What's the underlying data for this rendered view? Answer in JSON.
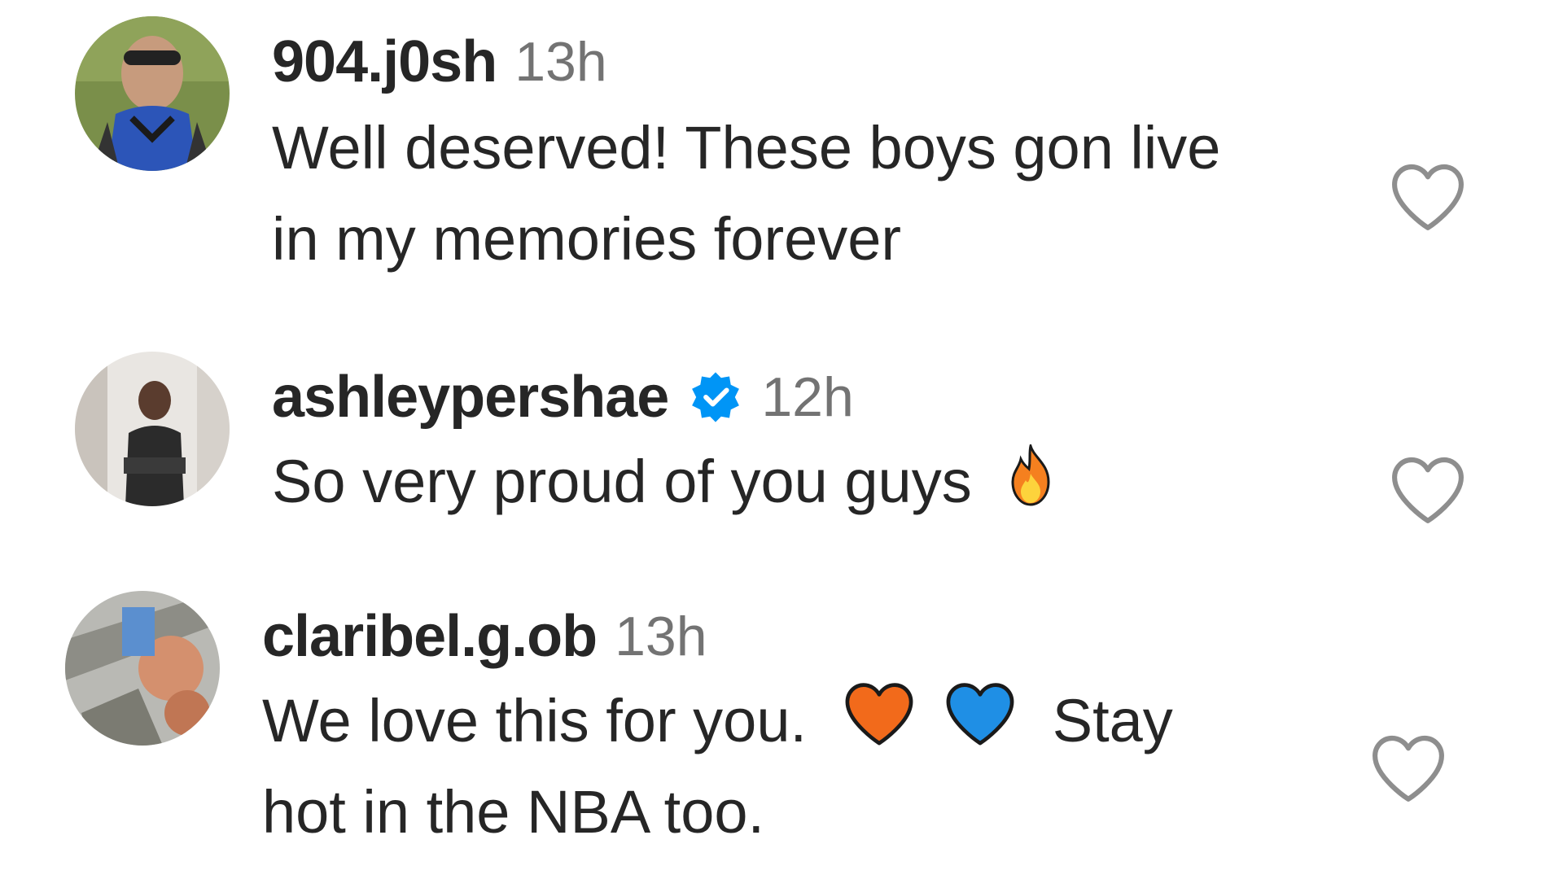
{
  "comments": [
    {
      "username": "904.j0sh",
      "time": "13h",
      "line1": "Well deserved! These boys gon live",
      "line2": "in my memories forever",
      "verified": false
    },
    {
      "username": "ashleypershae",
      "time": "12h",
      "line1": "So very proud of you guys",
      "verified": true,
      "emoji": "fire-emoji"
    },
    {
      "username": "claribel.g.ob",
      "time": "13h",
      "line1_a": "We love this for you.",
      "line1_b": "Stay",
      "line2": "hot in the NBA too.",
      "verified": false,
      "emojis": [
        "orange-heart-emoji",
        "blue-heart-emoji"
      ]
    }
  ],
  "icons": {
    "like": "heart-outline-icon",
    "verified": "verified-badge-icon"
  },
  "colors": {
    "text": "#262626",
    "muted": "#737373",
    "verified": "#0095f6"
  }
}
